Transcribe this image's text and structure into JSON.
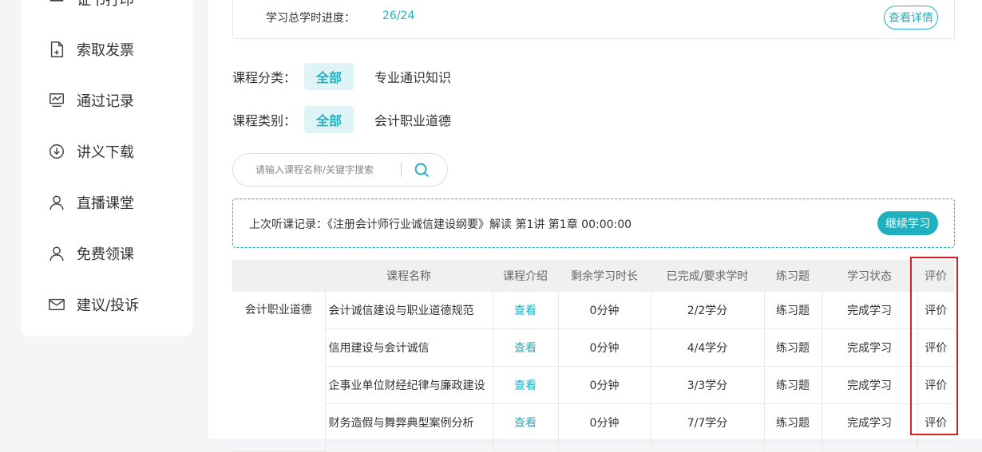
{
  "sidebar": {
    "items": [
      {
        "label": "证书打印",
        "icon": "certificate-icon"
      },
      {
        "label": "索取发票",
        "icon": "invoice-icon"
      },
      {
        "label": "通过记录",
        "icon": "monitor-chart-icon"
      },
      {
        "label": "讲义下载",
        "icon": "download-icon"
      },
      {
        "label": "直播课堂",
        "icon": "user-icon"
      },
      {
        "label": "免费领课",
        "icon": "user-icon"
      },
      {
        "label": "建议/投诉",
        "icon": "mail-icon"
      }
    ]
  },
  "progress": {
    "label": "学习总学时进度：",
    "value": "26/24",
    "detail_button": "查看详情"
  },
  "filters": {
    "category": {
      "label": "课程分类：",
      "active": "全部",
      "option": "专业通识知识"
    },
    "type": {
      "label": "课程类别：",
      "active": "全部",
      "option": "会计职业道德"
    }
  },
  "search": {
    "placeholder": "请输入课程名称/关键字搜索",
    "icon": "search-icon"
  },
  "last_record": {
    "text": "上次听课记录：《注册会计师行业诚信建设纲要》解读 第1讲 第1章 00:00:00",
    "button": "继续学习"
  },
  "table": {
    "headers": [
      "",
      "课程名称",
      "课程介绍",
      "剩余学习时长",
      "已完成/要求学时",
      "练习题",
      "学习状态",
      "评价"
    ],
    "category": "会计职业道德",
    "rows": [
      {
        "name": "会计诚信建设与职业道德规范",
        "intro": "查看",
        "remaining": "0分钟",
        "credits": "2/2学分",
        "exercise": "练习题",
        "status": "完成学习",
        "rating": "评价"
      },
      {
        "name": "信用建设与会计诚信",
        "intro": "查看",
        "remaining": "0分钟",
        "credits": "4/4学分",
        "exercise": "练习题",
        "status": "完成学习",
        "rating": "评价"
      },
      {
        "name": "企事业单位财经纪律与廉政建设",
        "intro": "查看",
        "remaining": "0分钟",
        "credits": "3/3学分",
        "exercise": "练习题",
        "status": "完成学习",
        "rating": "评价"
      },
      {
        "name": "财务造假与舞弊典型案例分析",
        "intro": "查看",
        "remaining": "0分钟",
        "credits": "7/7学分",
        "exercise": "练习题",
        "status": "完成学习",
        "rating": "评价"
      }
    ]
  },
  "colors": {
    "accent": "#20b1c0",
    "highlight": "#d62121"
  }
}
